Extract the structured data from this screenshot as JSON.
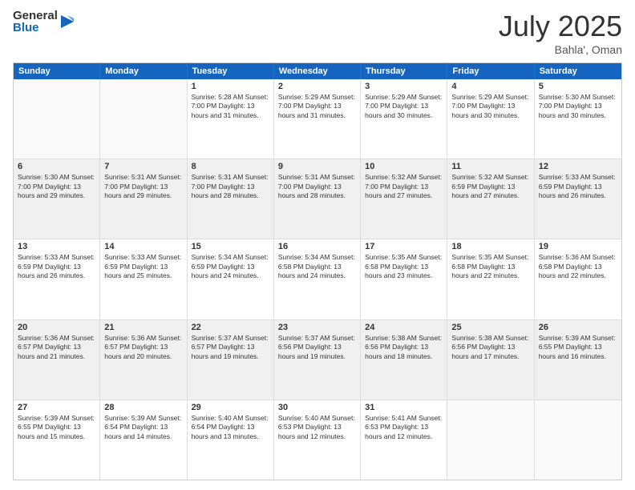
{
  "logo": {
    "general": "General",
    "blue": "Blue"
  },
  "title": "July 2025",
  "subtitle": "Bahla', Oman",
  "header_days": [
    "Sunday",
    "Monday",
    "Tuesday",
    "Wednesday",
    "Thursday",
    "Friday",
    "Saturday"
  ],
  "weeks": [
    [
      {
        "day": "",
        "text": "",
        "empty": true
      },
      {
        "day": "",
        "text": "",
        "empty": true
      },
      {
        "day": "1",
        "text": "Sunrise: 5:28 AM\nSunset: 7:00 PM\nDaylight: 13 hours and 31 minutes."
      },
      {
        "day": "2",
        "text": "Sunrise: 5:29 AM\nSunset: 7:00 PM\nDaylight: 13 hours and 31 minutes."
      },
      {
        "day": "3",
        "text": "Sunrise: 5:29 AM\nSunset: 7:00 PM\nDaylight: 13 hours and 30 minutes."
      },
      {
        "day": "4",
        "text": "Sunrise: 5:29 AM\nSunset: 7:00 PM\nDaylight: 13 hours and 30 minutes."
      },
      {
        "day": "5",
        "text": "Sunrise: 5:30 AM\nSunset: 7:00 PM\nDaylight: 13 hours and 30 minutes."
      }
    ],
    [
      {
        "day": "6",
        "text": "Sunrise: 5:30 AM\nSunset: 7:00 PM\nDaylight: 13 hours and 29 minutes."
      },
      {
        "day": "7",
        "text": "Sunrise: 5:31 AM\nSunset: 7:00 PM\nDaylight: 13 hours and 29 minutes."
      },
      {
        "day": "8",
        "text": "Sunrise: 5:31 AM\nSunset: 7:00 PM\nDaylight: 13 hours and 28 minutes."
      },
      {
        "day": "9",
        "text": "Sunrise: 5:31 AM\nSunset: 7:00 PM\nDaylight: 13 hours and 28 minutes."
      },
      {
        "day": "10",
        "text": "Sunrise: 5:32 AM\nSunset: 7:00 PM\nDaylight: 13 hours and 27 minutes."
      },
      {
        "day": "11",
        "text": "Sunrise: 5:32 AM\nSunset: 6:59 PM\nDaylight: 13 hours and 27 minutes."
      },
      {
        "day": "12",
        "text": "Sunrise: 5:33 AM\nSunset: 6:59 PM\nDaylight: 13 hours and 26 minutes."
      }
    ],
    [
      {
        "day": "13",
        "text": "Sunrise: 5:33 AM\nSunset: 6:59 PM\nDaylight: 13 hours and 26 minutes."
      },
      {
        "day": "14",
        "text": "Sunrise: 5:33 AM\nSunset: 6:59 PM\nDaylight: 13 hours and 25 minutes."
      },
      {
        "day": "15",
        "text": "Sunrise: 5:34 AM\nSunset: 6:59 PM\nDaylight: 13 hours and 24 minutes."
      },
      {
        "day": "16",
        "text": "Sunrise: 5:34 AM\nSunset: 6:58 PM\nDaylight: 13 hours and 24 minutes."
      },
      {
        "day": "17",
        "text": "Sunrise: 5:35 AM\nSunset: 6:58 PM\nDaylight: 13 hours and 23 minutes."
      },
      {
        "day": "18",
        "text": "Sunrise: 5:35 AM\nSunset: 6:58 PM\nDaylight: 13 hours and 22 minutes."
      },
      {
        "day": "19",
        "text": "Sunrise: 5:36 AM\nSunset: 6:58 PM\nDaylight: 13 hours and 22 minutes."
      }
    ],
    [
      {
        "day": "20",
        "text": "Sunrise: 5:36 AM\nSunset: 6:57 PM\nDaylight: 13 hours and 21 minutes."
      },
      {
        "day": "21",
        "text": "Sunrise: 5:36 AM\nSunset: 6:57 PM\nDaylight: 13 hours and 20 minutes."
      },
      {
        "day": "22",
        "text": "Sunrise: 5:37 AM\nSunset: 6:57 PM\nDaylight: 13 hours and 19 minutes."
      },
      {
        "day": "23",
        "text": "Sunrise: 5:37 AM\nSunset: 6:56 PM\nDaylight: 13 hours and 19 minutes."
      },
      {
        "day": "24",
        "text": "Sunrise: 5:38 AM\nSunset: 6:56 PM\nDaylight: 13 hours and 18 minutes."
      },
      {
        "day": "25",
        "text": "Sunrise: 5:38 AM\nSunset: 6:56 PM\nDaylight: 13 hours and 17 minutes."
      },
      {
        "day": "26",
        "text": "Sunrise: 5:39 AM\nSunset: 6:55 PM\nDaylight: 13 hours and 16 minutes."
      }
    ],
    [
      {
        "day": "27",
        "text": "Sunrise: 5:39 AM\nSunset: 6:55 PM\nDaylight: 13 hours and 15 minutes."
      },
      {
        "day": "28",
        "text": "Sunrise: 5:39 AM\nSunset: 6:54 PM\nDaylight: 13 hours and 14 minutes."
      },
      {
        "day": "29",
        "text": "Sunrise: 5:40 AM\nSunset: 6:54 PM\nDaylight: 13 hours and 13 minutes."
      },
      {
        "day": "30",
        "text": "Sunrise: 5:40 AM\nSunset: 6:53 PM\nDaylight: 13 hours and 12 minutes."
      },
      {
        "day": "31",
        "text": "Sunrise: 5:41 AM\nSunset: 6:53 PM\nDaylight: 13 hours and 12 minutes."
      },
      {
        "day": "",
        "text": "",
        "empty": true
      },
      {
        "day": "",
        "text": "",
        "empty": true
      }
    ]
  ]
}
